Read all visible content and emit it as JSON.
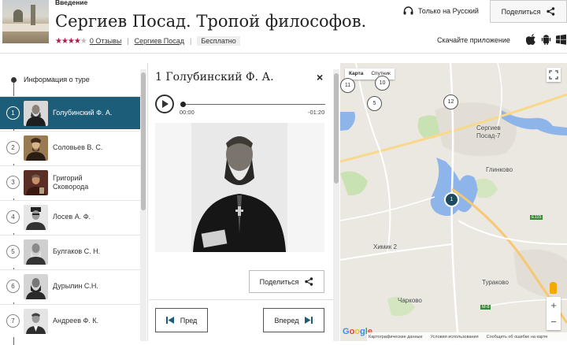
{
  "header": {
    "subtitle": "Введение",
    "title": "Сергиев Посад. Тропой философов.",
    "rating_stars": 4,
    "reviews_link": "0 Отзывы",
    "city_link": "Сергиев Посад",
    "price_badge": "Бесплатно",
    "language_label": "Только на Русский",
    "share_label": "Поделиться",
    "app_label": "Скачайте приложение"
  },
  "sidebar": {
    "info_label": "Информация о туре",
    "items": [
      {
        "num": "1",
        "label": "Голубинский Ф. А."
      },
      {
        "num": "2",
        "label": "Соловьев В. С."
      },
      {
        "num": "3",
        "label": "Григорий Сковорода"
      },
      {
        "num": "4",
        "label": "Лосев А. Ф."
      },
      {
        "num": "5",
        "label": "Булгаков С. Н."
      },
      {
        "num": "6",
        "label": "Дурылин С.Н."
      },
      {
        "num": "7",
        "label": "Андреев Ф. К."
      }
    ],
    "active_index": 0
  },
  "panel": {
    "title": "1 Голубинский Ф. А.",
    "close_symbol": "×",
    "time_current": "00:00",
    "time_remaining": "-01:20",
    "progress": 0,
    "share_label": "Поделиться",
    "prev_label": "Пред",
    "next_label": "Вперед"
  },
  "map": {
    "type_map": "Карта",
    "type_sat": "Спутник",
    "places": {
      "sergiev_posad": "Сергиев Посад-7",
      "sergiev_posad_a": "Сергиев",
      "sergiev_posad_b": "Посад-7",
      "glinkovo": "Глинково",
      "khimik": "Химик 2",
      "turakovo": "Тураково",
      "charkovo": "Чарково",
      "road_e115": "E115",
      "road_m8": "M-8"
    },
    "markers": [
      "10",
      "11",
      "5",
      "12",
      "1"
    ],
    "google": "Google",
    "footer": [
      "Картографические данные",
      "Условия использования",
      "Сообщить об ошибке на карте"
    ]
  },
  "colors": {
    "accent": "#1c5d79",
    "stars": "#b0174e",
    "map_water": "#8db5ea",
    "map_green": "#c9e2b3"
  }
}
